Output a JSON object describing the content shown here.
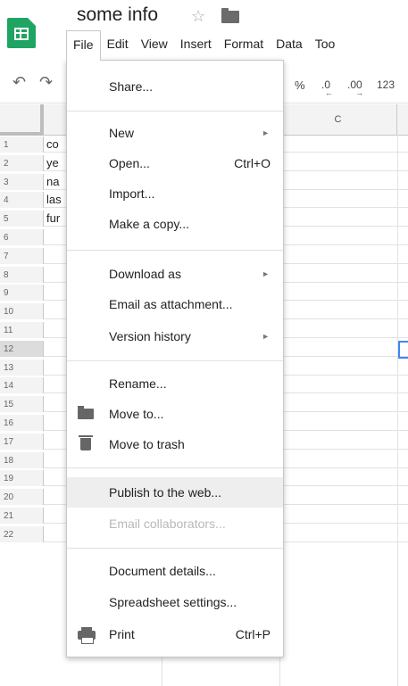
{
  "document": {
    "title": "some info"
  },
  "menubar": {
    "items": [
      {
        "label": "File"
      },
      {
        "label": "Edit"
      },
      {
        "label": "View"
      },
      {
        "label": "Insert"
      },
      {
        "label": "Format"
      },
      {
        "label": "Data"
      },
      {
        "label": "Too"
      }
    ]
  },
  "toolbar": {
    "percent": "%",
    "decrease_decimals": ".0",
    "increase_decimals": ".00",
    "number_format": "123"
  },
  "sheet": {
    "column_headers": [
      "C"
    ],
    "rows": [
      {
        "num": "1",
        "a": "co"
      },
      {
        "num": "2",
        "a": "ye"
      },
      {
        "num": "3",
        "a": "na"
      },
      {
        "num": "4",
        "a": "las"
      },
      {
        "num": "5",
        "a": "fur"
      },
      {
        "num": "6",
        "a": ""
      },
      {
        "num": "7",
        "a": ""
      },
      {
        "num": "8",
        "a": ""
      },
      {
        "num": "9",
        "a": ""
      },
      {
        "num": "10",
        "a": ""
      },
      {
        "num": "11",
        "a": ""
      },
      {
        "num": "12",
        "a": ""
      },
      {
        "num": "13",
        "a": ""
      },
      {
        "num": "14",
        "a": ""
      },
      {
        "num": "15",
        "a": ""
      },
      {
        "num": "16",
        "a": ""
      },
      {
        "num": "17",
        "a": ""
      },
      {
        "num": "18",
        "a": ""
      },
      {
        "num": "19",
        "a": ""
      },
      {
        "num": "20",
        "a": ""
      },
      {
        "num": "21",
        "a": ""
      },
      {
        "num": "22",
        "a": ""
      }
    ],
    "selected_row": "12"
  },
  "file_menu": {
    "share": "Share...",
    "new": "New",
    "open": "Open...",
    "open_shortcut": "Ctrl+O",
    "import": "Import...",
    "make_copy": "Make a copy...",
    "download_as": "Download as",
    "email_attachment": "Email as attachment...",
    "version_history": "Version history",
    "rename": "Rename...",
    "move_to": "Move to...",
    "move_to_trash": "Move to trash",
    "publish_web": "Publish to the web...",
    "email_collaborators": "Email collaborators...",
    "document_details": "Document details...",
    "spreadsheet_settings": "Spreadsheet settings...",
    "print": "Print",
    "print_shortcut": "Ctrl+P"
  },
  "colors": {
    "sheets_green": "#1fa463",
    "menu_highlight": "#eeeeee",
    "disabled_text": "#b8b8b8",
    "selection_blue": "#4285f4"
  }
}
